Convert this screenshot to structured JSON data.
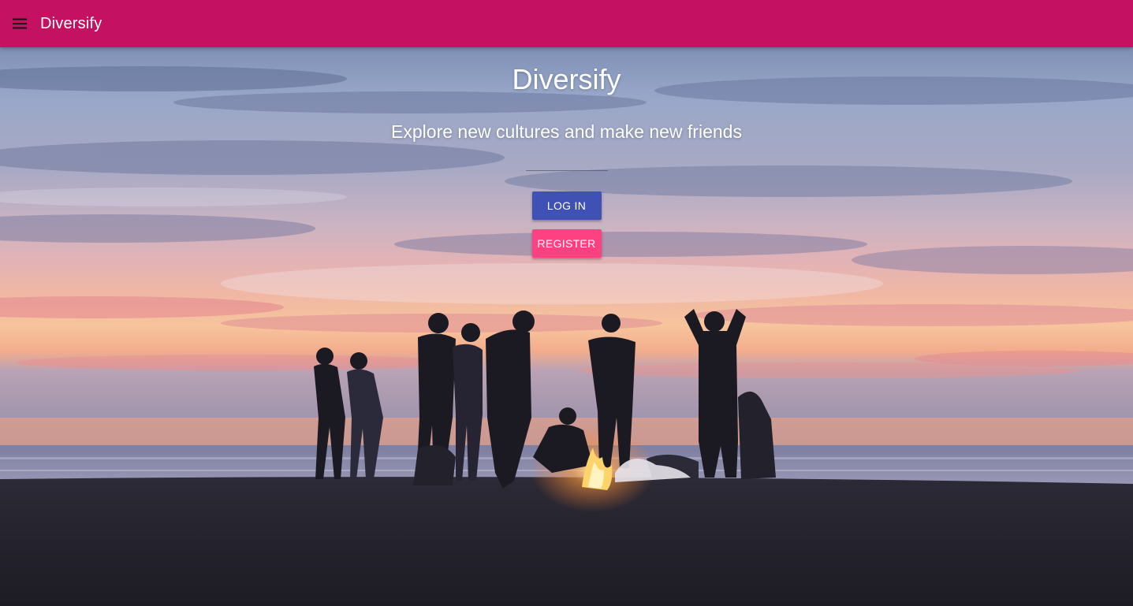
{
  "colors": {
    "appbar": "#c51162",
    "login_button": "#3f51b5",
    "register_button": "#ff4081"
  },
  "appbar": {
    "menu_icon": "hamburger-menu-icon",
    "title": "Diversify"
  },
  "hero": {
    "title": "Diversify",
    "tagline": "Explore new cultures and make new friends",
    "login_label": "LOG IN",
    "register_label": "REGISTER"
  }
}
